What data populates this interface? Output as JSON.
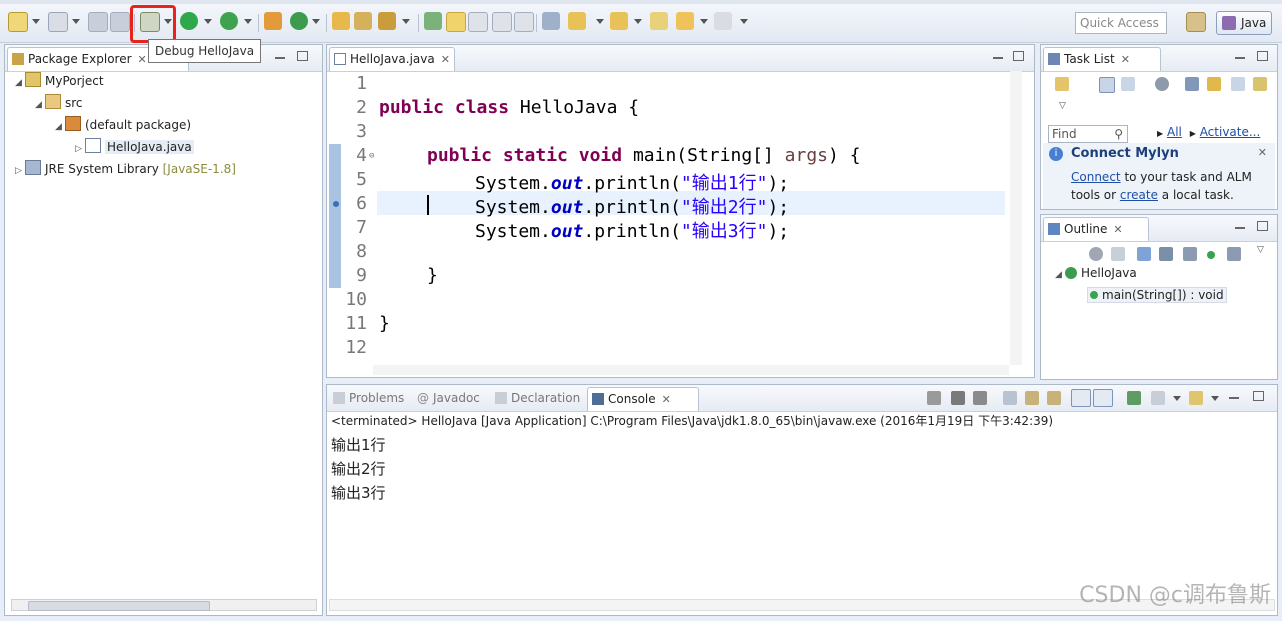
{
  "toolbar": {
    "debug_tooltip": "Debug HelloJava",
    "quick_access_placeholder": "Quick Access",
    "perspective_label": "Java"
  },
  "package_explorer": {
    "tab_label": "Package Explorer",
    "tree": [
      {
        "label": "MyPorject",
        "level": 0
      },
      {
        "label": "src",
        "level": 1
      },
      {
        "label": "(default package)",
        "level": 2
      },
      {
        "label": "HelloJava.java",
        "level": 3
      },
      {
        "label": "JRE System Library",
        "extra": "[JavaSE-1.8]",
        "level": 0
      }
    ]
  },
  "editor": {
    "tab_label": "HelloJava.java",
    "line_numbers": [
      "1",
      "2",
      "3",
      "4",
      "5",
      "6",
      "7",
      "8",
      "9",
      "10",
      "11",
      "12"
    ],
    "code": {
      "l2_kw1": "public",
      "l2_kw2": "class",
      "l2_rest": " HelloJava {",
      "l4_kw1": "public",
      "l4_kw2": "static",
      "l4_kw3": "void",
      "l4_m": " main(String[] ",
      "l4_param": "args",
      "l4_end": ") {",
      "sys": "System.",
      "out": "out",
      "println": ".println(",
      "s1": "\"输出1行\"",
      "s2": "\"输出2行\"",
      "s3": "\"输出3行\"",
      "end": ");",
      "close_brace": "}"
    }
  },
  "task_list": {
    "tab_label": "Task List",
    "find_placeholder": "Find",
    "all_label": "All",
    "activate_label": "Activate...",
    "mylyn_title": "Connect Mylyn",
    "mylyn_connect": "Connect",
    "mylyn_text1": " to your task and ALM",
    "mylyn_text2": "tools or ",
    "mylyn_create": "create",
    "mylyn_text3": " a local task."
  },
  "outline": {
    "tab_label": "Outline",
    "class_name": "HelloJava",
    "method": "main(String[]) : void"
  },
  "bottom_tabs": {
    "problems": "Problems",
    "javadoc": "Javadoc",
    "declaration": "Declaration",
    "console": "Console"
  },
  "console": {
    "header": "<terminated> HelloJava [Java Application] C:\\Program Files\\Java\\jdk1.8.0_65\\bin\\javaw.exe (2016年1月19日 下午3:42:39)",
    "lines": [
      "输出1行",
      "输出2行",
      "输出3行"
    ]
  },
  "watermark": "CSDN @c调布鲁斯",
  "colors": {
    "keyword": "#7f0055",
    "string": "#2a00ff",
    "field": "#0000c0",
    "highlight_box": "#e8231a"
  }
}
